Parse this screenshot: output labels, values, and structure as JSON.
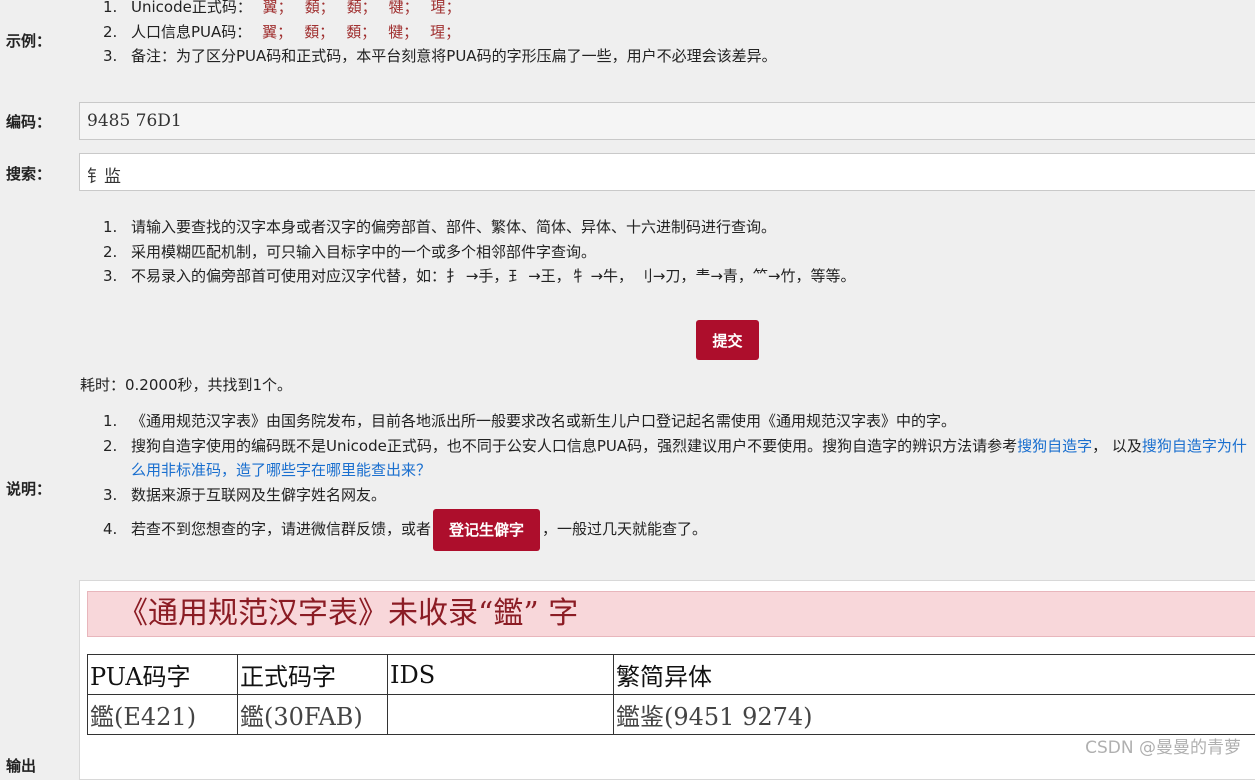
{
  "labels": {
    "example": "示例：",
    "code": "编码：",
    "search": "搜索：",
    "notes": "说明：",
    "output": "输出"
  },
  "examples": [
    {
      "num": "1.",
      "label": "Unicode正式码：",
      "chars": [
        "翼；",
        "䫋；",
        "䫋；",
        "犍；",
        "瑆；"
      ]
    },
    {
      "num": "2.",
      "label": "人口信息PUA码：",
      "chars": [
        "翼；",
        "䫋；",
        "䫋；",
        "犍；",
        "瑆；"
      ]
    },
    {
      "num": "3.",
      "text": "备注：为了区分PUA码和正式码，本平台刻意将PUA码的字形压扁了一些，用户不必理会该差异。"
    }
  ],
  "code_field": {
    "value": "9485 76D1"
  },
  "search_field": {
    "value": "钅监"
  },
  "tips": [
    {
      "num": "1.",
      "text": "请输入要查找的汉字本身或者汉字的偏旁部首、部件、繁体、简体、异体、十六进制码进行查询。"
    },
    {
      "num": "2.",
      "text": "采用模糊匹配机制，可只输入目标字中的一个或多个相邻部件字查询。"
    },
    {
      "num": "3.",
      "text": "不易录入的偏旁部首可使用对应汉字代替，如：扌 →手，𤣩 →王，牜 →牛， 刂→刀，龶→青，⺮→竹，等等。"
    }
  ],
  "submit_label": "提交",
  "timing": "耗时：0.2000秒，共找到1个。",
  "notes": {
    "n1": {
      "num": "1.",
      "text": "《通用规范汉字表》由国务院发布，目前各地派出所一般要求改名或新生儿户口登记起名需使用《通用规范汉字表》中的字。"
    },
    "n2": {
      "num": "2.",
      "text_a": "搜狗自造字使用的编码既不是Unicode正式码，也不同于公安人口信息PUA码，强烈建议用户不要使用。搜狗自造字的辨识方法请参考",
      "link_a": "搜狗自造字",
      "text_b": "，  以及",
      "link_b": "搜狗自造字为什么用非标准码，造了哪些字在哪里能查出来？"
    },
    "n3": {
      "num": "3.",
      "text": "数据来源于互联网及生僻字姓名网友。"
    },
    "n4": {
      "num": "4.",
      "text_a": "若查不到您想查的字，请进微信群反馈，或者",
      "button": "登记生僻字",
      "text_b": "，一般过几天就能查了。"
    }
  },
  "result": {
    "banner": "《通用规范汉字表》未收录“鑑”  字",
    "headers": [
      "PUA码字",
      "正式码字",
      "IDS",
      "繁简异体"
    ],
    "row": [
      "鑑(E421)",
      "鑑(30FAB)",
      "",
      "鑑鉴(9451 9274)"
    ]
  },
  "watermark": "CSDN @曼曼的青萝",
  "colors": {
    "accent": "#ad0e2c",
    "banner_bg": "#f8d7da",
    "link": "#1a6fcf"
  }
}
